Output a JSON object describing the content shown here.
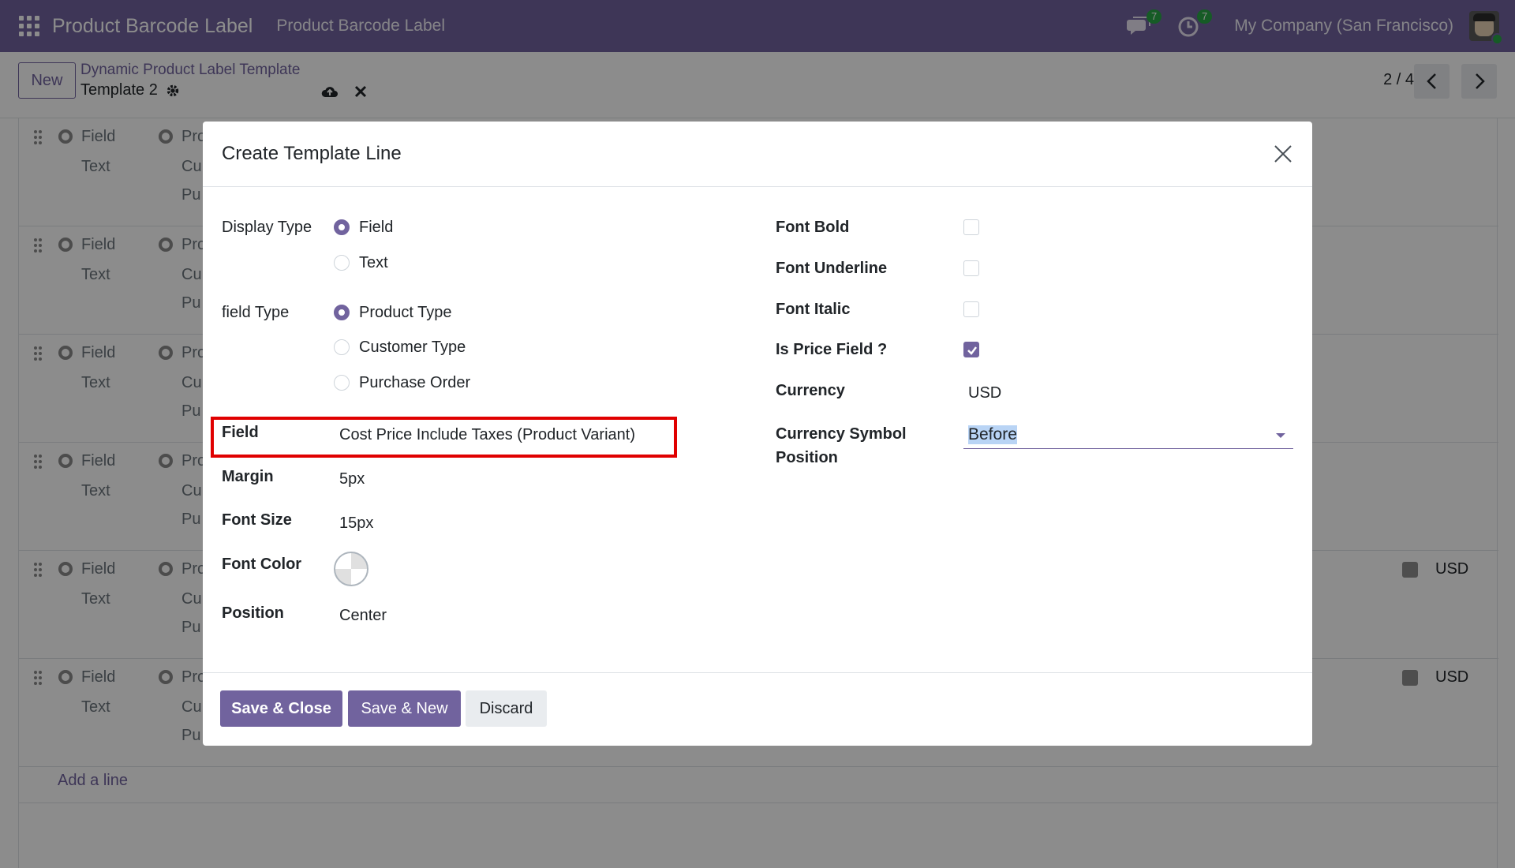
{
  "navbar": {
    "app_name": "Product Barcode Label",
    "menu_item": "Product Barcode Label",
    "messages_count": "7",
    "activities_count": "7",
    "company": "My Company (San Francisco)"
  },
  "control_panel": {
    "new_button": "New",
    "breadcrumb_parent": "Dynamic Product Label Template",
    "breadcrumb_current": "Template 2",
    "pager": "2 / 4"
  },
  "list": {
    "rows": [
      {
        "display_field": "Field",
        "display_text": "Text",
        "type_1": "Pro",
        "type_2": "Cu",
        "type_3": "Pu",
        "currency": ""
      },
      {
        "display_field": "Field",
        "display_text": "Text",
        "type_1": "Pro",
        "type_2": "Cu",
        "type_3": "Pu",
        "currency": ""
      },
      {
        "display_field": "Field",
        "display_text": "Text",
        "type_1": "Pro",
        "type_2": "Cu",
        "type_3": "Pu",
        "currency": ""
      },
      {
        "display_field": "Field",
        "display_text": "Text",
        "type_1": "Pro",
        "type_2": "Cu",
        "type_3": "Pu",
        "currency": ""
      },
      {
        "display_field": "Field",
        "display_text": "Text",
        "type_1": "Pro",
        "type_2": "Cu",
        "type_3": "Pu",
        "currency": "USD"
      },
      {
        "display_field": "Field",
        "display_text": "Text",
        "type_1": "Pro",
        "type_2": "Cu",
        "type_3": "Pu",
        "currency": "USD"
      }
    ],
    "add_line": "Add a line"
  },
  "modal": {
    "title": "Create Template Line",
    "left": {
      "display_type_label": "Display Type",
      "display_type_options": [
        "Field",
        "Text"
      ],
      "display_type_selected": "Field",
      "field_type_label": "field Type",
      "field_type_options": [
        "Product Type",
        "Customer Type",
        "Purchase Order"
      ],
      "field_type_selected": "Product Type",
      "field_label": "Field",
      "field_value": "Cost Price Include Taxes (Product Variant)",
      "margin_label": "Margin",
      "margin_value": "5px",
      "font_size_label": "Font Size",
      "font_size_value": "15px",
      "font_color_label": "Font Color",
      "position_label": "Position",
      "position_value": "Center"
    },
    "right": {
      "font_bold_label": "Font Bold",
      "font_bold_checked": false,
      "font_underline_label": "Font Underline",
      "font_underline_checked": false,
      "font_italic_label": "Font Italic",
      "font_italic_checked": false,
      "is_price_label": "Is Price Field ?",
      "is_price_checked": true,
      "currency_label": "Currency",
      "currency_value": "USD",
      "symbol_position_label_1": "Currency Symbol",
      "symbol_position_label_2": "Position",
      "symbol_position_value": "Before"
    },
    "footer": {
      "save_close": "Save & Close",
      "save_new": "Save & New",
      "discard": "Discard"
    }
  },
  "colors": {
    "brand": "#71639e",
    "highlight": "#e00000",
    "success": "#28a745"
  }
}
